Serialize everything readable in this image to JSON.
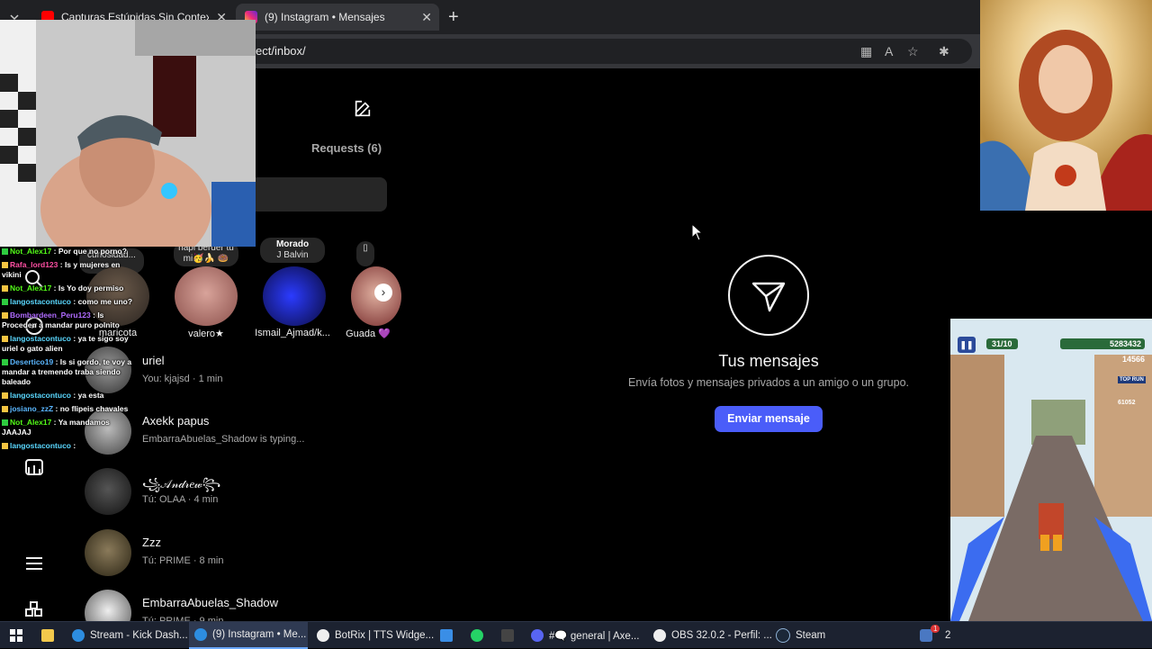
{
  "browser": {
    "tabs": [
      {
        "label": "Capturas Estúpidas Sin Contexto",
        "active": false
      },
      {
        "label": "(9) Instagram • Mensajes",
        "active": true
      }
    ],
    "url": "ect/inbox/",
    "close_glyph": "✕",
    "new_tab_glyph": "+"
  },
  "instagram": {
    "requests_label": "Requests (6)",
    "notes": [
      {
        "line1": "curiosidad..."
      },
      {
        "line1": "napi berder tu",
        "line2": "mi🥳🍌 🍩"
      },
      {
        "line1": "Morado",
        "line2": "J Balvin"
      },
      {
        "line1": "▯"
      }
    ],
    "stories": [
      {
        "name": "maricota"
      },
      {
        "name": "valero★"
      },
      {
        "name": "Ismail_Ajmad/k..."
      },
      {
        "name": "Guada 💜"
      }
    ],
    "next_glyph": "›",
    "conversations": [
      {
        "name": "uriel",
        "preview": "You: kjajsd · 1 min"
      },
      {
        "name": "Axekk papus",
        "preview": "EmbarraAbuelas_Shadow is typing..."
      },
      {
        "name": "꧁𝒜𝓃𝒹𝓇𝑒𝓌꧂",
        "preview": "Tú: OLAA · 4 min"
      },
      {
        "name": "Zzz",
        "preview": "Tú: PRIME · 8 min"
      },
      {
        "name": "EmbarraAbuelas_Shadow",
        "preview": "Tú: PRIME · 9 min"
      }
    ],
    "empty_state": {
      "title": "Tus mensajes",
      "subtitle": "Envía fotos y mensajes privados a un amigo o un grupo.",
      "button": "Enviar mensaje"
    }
  },
  "chat": [
    {
      "user": "Not_Alex17",
      "color": "green",
      "text": ": Por que no porno?"
    },
    {
      "user": "Rafa_lord123",
      "color": "pink",
      "text": ": Is y mujeres en vikini"
    },
    {
      "user": "Not_Alex17",
      "color": "green",
      "text": ": Is Yo doy permiso"
    },
    {
      "user": "langostacontuco",
      "color": "cyan",
      "text": ": como me uno?"
    },
    {
      "user": "Bombardeen_Peru123",
      "color": "purple",
      "text": ": Is Proceden a mandar puro polnito"
    },
    {
      "user": "langostacontuco",
      "color": "cyan",
      "text": ": ya te sigo soy uriel o gato alien"
    },
    {
      "user": "Desertico19",
      "color": "blue",
      "text": ": Is si gordo, te voy a mandar a tremendo traba siendo baleado"
    },
    {
      "user": "langostacontuco",
      "color": "cyan",
      "text": ": ya esta"
    },
    {
      "user": "josiano_zzZ",
      "color": "blue",
      "text": ": no flipeis chavales"
    },
    {
      "user": "Not_Alex17",
      "color": "green",
      "text": ": Ya mandamos JAAJAJ"
    },
    {
      "user": "langostacontuco",
      "color": "cyan",
      "text": ": "
    }
  ],
  "game": {
    "tickets": "31/10",
    "score": "5283432",
    "coins": "14566",
    "top_run_label": "TOP RUN",
    "top_run_value": "61052"
  },
  "taskbar": {
    "items": [
      {
        "label": "Stream - Kick Dash...",
        "active": false
      },
      {
        "label": "(9) Instagram • Me...",
        "active": true
      },
      {
        "label": "BotRix | TTS Widge...",
        "active": false
      },
      {
        "label": "#🗨️ general | Axe...",
        "active": false
      },
      {
        "label": "OBS 32.0.2 - Perfil: ...",
        "active": false
      },
      {
        "label": "Steam",
        "active": false
      }
    ],
    "notif_count": "1",
    "right_label": "2"
  },
  "colors": {
    "accent": "#4a5df9",
    "ig_bg": "#000000",
    "browser_chrome": "#202124"
  }
}
